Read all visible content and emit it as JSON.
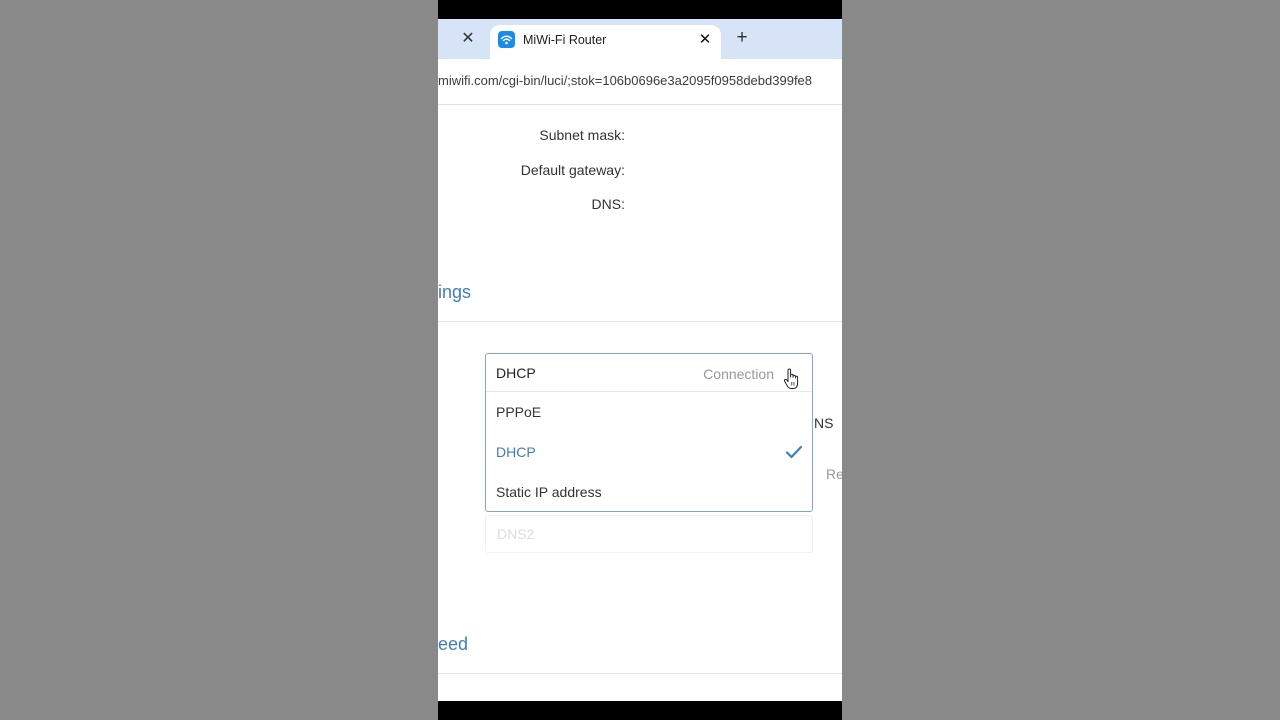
{
  "browser": {
    "tab_title": "MiWi-Fi Router",
    "tab_close_glyph": "✕",
    "new_tab_glyph": "+",
    "url": "miwifi.com/cgi-bin/luci/;stok=106b0696e3a2095f0958debd399fe8"
  },
  "status_fields": {
    "subnet_mask_label": "Subnet mask:",
    "default_gateway_label": "Default gateway:",
    "dns_label": "DNS:"
  },
  "sections": {
    "settings_title_partial": "ings",
    "speed_title_partial": "eed"
  },
  "background_partials": {
    "dns_partial": "NS",
    "re_partial": "Re",
    "dns2_placeholder": "DNS2"
  },
  "connection_dropdown": {
    "selected_value": "DHCP",
    "label": "Connection",
    "options": [
      {
        "label": "PPPoE",
        "selected": false
      },
      {
        "label": "DHCP",
        "selected": true
      },
      {
        "label": "Static IP address",
        "selected": false
      }
    ]
  },
  "colors": {
    "accent": "#3e7fb8",
    "tabstrip": "#d7e3f7",
    "favicon": "#1a8be8"
  },
  "icons": {
    "favicon": "wifi-icon",
    "cursor": "hand-pointer-icon",
    "selected_marker": "checkmark-icon"
  }
}
